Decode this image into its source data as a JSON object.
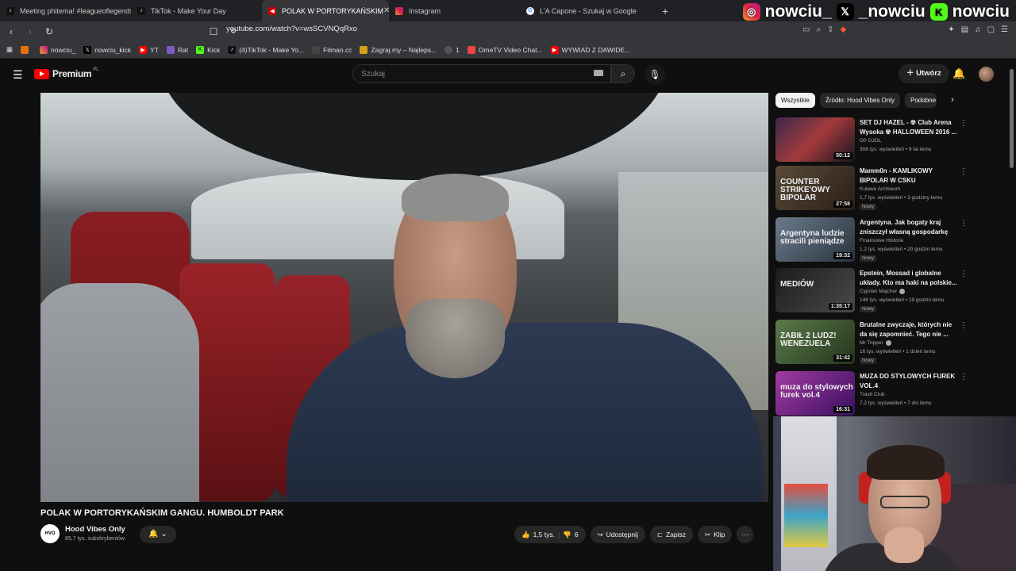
{
  "tabs": [
    {
      "label": "Meeting phitema! #leagueoflegends",
      "icon": "tiktok-icon",
      "active": false
    },
    {
      "label": "TikTok - Make Your Day",
      "icon": "tiktok-icon",
      "active": false
    },
    {
      "label": "POLAK W PORTORYKAŃSKIM",
      "icon": "speaker-icon",
      "active": true
    },
    {
      "label": "Instagram",
      "icon": "instagram-icon",
      "active": false
    },
    {
      "label": "L'A Capone - Szukaj w Google",
      "icon": "google-icon",
      "active": false
    }
  ],
  "socials": {
    "instagram": "nowciu_",
    "x": "_nowciu",
    "kick": "nowciu"
  },
  "url": "youtube.com/watch?v=wsSCVNQqRxo",
  "bookmarks": [
    "nowciu_",
    "nowciu_kick",
    "YT",
    "Rat",
    "Kick",
    "(4)TikTok - Make Yo...",
    "Filman.cc",
    "Zagraj.my – Najleps...",
    "1",
    "OmeTV Video Chat...",
    "WYWIAD Z DAWIDE..."
  ],
  "yt": {
    "logo": "Premium",
    "logo_region": "PL",
    "search_placeholder": "Szukaj",
    "create_label": "Utwórz"
  },
  "video": {
    "title": "POLAK W PORTORYKAŃSKIM GANGU. HUMBOLDT PARK",
    "channel": "Hood Vibes Only",
    "channel_avatar_text": "HVO",
    "subscribers": "85,7 tys. subskrybentów",
    "likes": "1,5 tys.",
    "dislikes": "6",
    "share": "Udostępnij",
    "save": "Zapisz",
    "clip": "Klip"
  },
  "chips": [
    "Wszystkie",
    "Źródło: Hood Vibes Only",
    "Podobne"
  ],
  "recommendations": [
    {
      "title": "SET DJ HAZEL - ☢ Club Arena Wysoka ☢ HALLOWEEN 2016 ...",
      "channel": "G0 GJOL",
      "meta": "308 tys. wyświetleń • 9 lat temu",
      "duration": "50:12",
      "new": "",
      "thumb_text": "",
      "bg": "linear-gradient(135deg,#3b2a4a,#a33a3a,#151520)"
    },
    {
      "title": "Mamm0n - KAMLIKOWY BIPOLAR W CSKU",
      "channel": "Kulawe Archiwum",
      "meta": "1,7 tys. wyświetleń • 3 godziny temu",
      "duration": "27:58",
      "new": "Nowy",
      "thumb_text": "COUNTER STRIKE'OWY BIPOLAR",
      "bg": "linear-gradient(135deg,#5a4a38,#2a1f17)"
    },
    {
      "title": "Argentyna. Jak bogaty kraj zniszczył własną gospodarkę",
      "channel": "Finansowe Historie",
      "meta": "1,2 tys. wyświetleń • 20 godzin temu",
      "duration": "19:32",
      "new": "Nowy",
      "thumb_text": "Argentyna ludzie stracili pieniądze",
      "bg": "linear-gradient(135deg,#6b7a8a,#2a3440)"
    },
    {
      "title": "Epstein, Mossad i globalne układy. Kto ma haki na polskie...",
      "channel": "Cyprian Majcher",
      "meta": "146 tys. wyświetleń • 19 godzin temu",
      "duration": "1:35:17",
      "new": "Nowy",
      "thumb_text": "MEDIÓW",
      "bg": "linear-gradient(135deg,#1c1c1c,#4a4a4a)",
      "verified": true
    },
    {
      "title": "Brutalne zwyczaje, których nie da się zapomnieć. Tego nie ...",
      "channel": "Mr Tripper",
      "meta": "16 tys. wyświetleń • 1 dzień temu",
      "duration": "31:42",
      "new": "Nowy",
      "thumb_text": "ZABIŁ 2 LUDZ! WENEZUELA",
      "bg": "linear-gradient(135deg,#5b7a4a,#23351c)",
      "verified": true
    },
    {
      "title": "MUZA DO STYLOWYCH FUREK VOL.4",
      "channel": "Trash Club",
      "meta": "7,2 tys. wyświetleń • 7 dni temu",
      "duration": "16:31",
      "new": "",
      "thumb_text": "muza do stylowych furek vol.4",
      "bg": "linear-gradient(135deg,#a03aa0,#3a1060)"
    }
  ],
  "colors": {
    "yt_red": "#ff0000",
    "bg": "#0f0f0f",
    "chip": "#272727"
  }
}
